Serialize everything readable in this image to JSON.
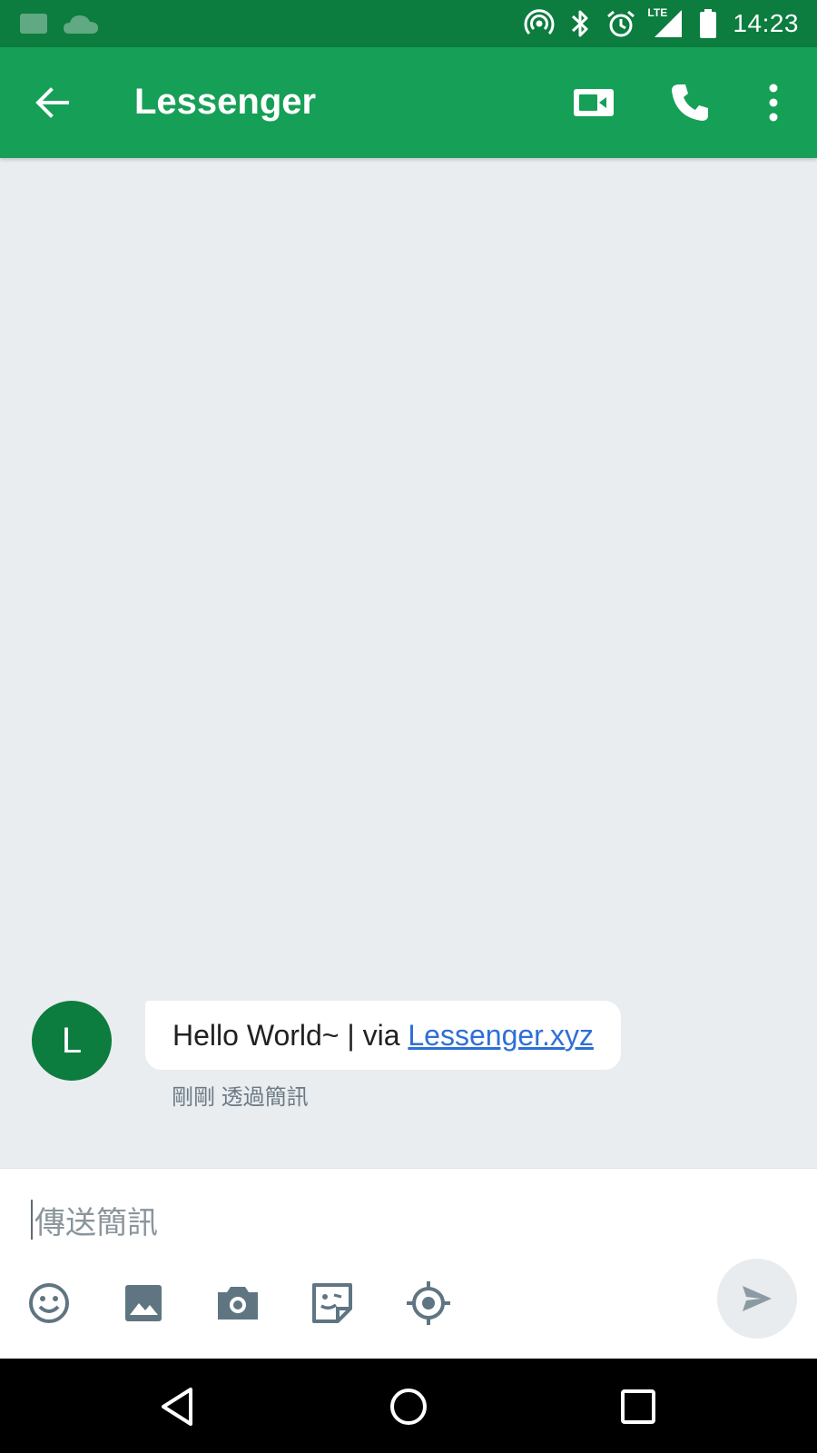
{
  "status_bar": {
    "time": "14:23",
    "network_label": "LTE",
    "icons": [
      "gallery-notification-icon",
      "cloud-notification-icon",
      "hotspot-icon",
      "bluetooth-icon",
      "alarm-icon",
      "lte-signal-icon",
      "battery-icon"
    ]
  },
  "app_bar": {
    "title": "Lessenger",
    "icons": [
      "back-arrow-icon",
      "video-call-icon",
      "phone-icon",
      "more-vert-icon"
    ]
  },
  "conversation": {
    "messages": [
      {
        "avatar_initial": "L",
        "text": "Hello World~ | via ",
        "link_text": "Lessenger.xyz",
        "meta": "剛剛 透過簡訊"
      }
    ]
  },
  "composer": {
    "placeholder": "傳送簡訊",
    "tools": [
      "emoji-icon",
      "image-icon",
      "camera-icon",
      "sticker-icon",
      "location-icon"
    ],
    "send_icon": "send-icon"
  },
  "nav_bar": {
    "icons": [
      "nav-back-icon",
      "nav-home-icon",
      "nav-recents-icon"
    ]
  },
  "colors": {
    "status_bar": "#0c7c3f",
    "app_bar": "#169f56",
    "avatar": "#0c7c3f",
    "link": "#2f6fd6",
    "background": "#eaedf0"
  }
}
